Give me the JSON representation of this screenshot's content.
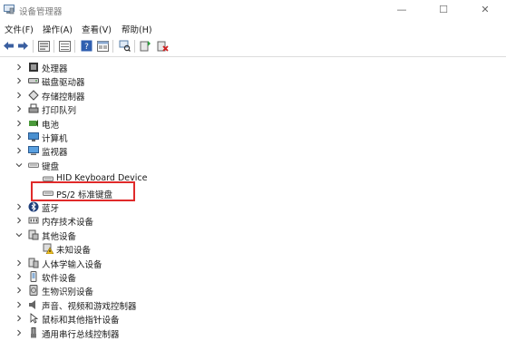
{
  "window": {
    "title": "设备管理器"
  },
  "menu": [
    "文件(F)",
    "操作(A)",
    "查看(V)",
    "帮助(H)"
  ],
  "toolbar": [
    "back-icon",
    "forward-icon",
    "properties-icon",
    "list-icon",
    "help-icon",
    "view-icon",
    "scan-icon",
    "update-driver-icon",
    "disable-icon"
  ],
  "tree": [
    {
      "label": "处理器",
      "icon": "processor-icon",
      "expanded": false,
      "level": 0
    },
    {
      "label": "磁盘驱动器",
      "icon": "disk-drive-icon",
      "expanded": false,
      "level": 0
    },
    {
      "label": "存储控制器",
      "icon": "storage-controller-icon",
      "expanded": false,
      "level": 0
    },
    {
      "label": "打印队列",
      "icon": "print-queue-icon",
      "expanded": false,
      "level": 0
    },
    {
      "label": "电池",
      "icon": "battery-icon",
      "expanded": false,
      "level": 0
    },
    {
      "label": "计算机",
      "icon": "computer-icon",
      "expanded": false,
      "level": 0
    },
    {
      "label": "监视器",
      "icon": "monitor-icon",
      "expanded": false,
      "level": 0
    },
    {
      "label": "键盘",
      "icon": "keyboard-icon",
      "expanded": true,
      "level": 0
    },
    {
      "label": "HID Keyboard Device",
      "icon": "keyboard-icon",
      "level": 1
    },
    {
      "label": "PS/2 标准键盘",
      "icon": "keyboard-icon",
      "level": 1,
      "highlighted": true
    },
    {
      "label": "蓝牙",
      "icon": "bluetooth-icon",
      "expanded": false,
      "level": 0
    },
    {
      "label": "内存技术设备",
      "icon": "memory-device-icon",
      "expanded": false,
      "level": 0
    },
    {
      "label": "其他设备",
      "icon": "other-devices-icon",
      "expanded": true,
      "level": 0
    },
    {
      "label": "未知设备",
      "icon": "unknown-device-warning-icon",
      "level": 1
    },
    {
      "label": "人体学输入设备",
      "icon": "hid-icon",
      "expanded": false,
      "level": 0
    },
    {
      "label": "软件设备",
      "icon": "software-device-icon",
      "expanded": false,
      "level": 0
    },
    {
      "label": "生物识别设备",
      "icon": "biometric-icon",
      "expanded": false,
      "level": 0
    },
    {
      "label": "声音、视频和游戏控制器",
      "icon": "audio-icon",
      "expanded": false,
      "level": 0
    },
    {
      "label": "鼠标和其他指针设备",
      "icon": "mouse-icon",
      "expanded": false,
      "level": 0
    },
    {
      "label": "通用串行总线控制器",
      "icon": "usb-icon",
      "expanded": false,
      "level": 0
    }
  ],
  "colors": {
    "highlight_border": "#e02a2a"
  }
}
